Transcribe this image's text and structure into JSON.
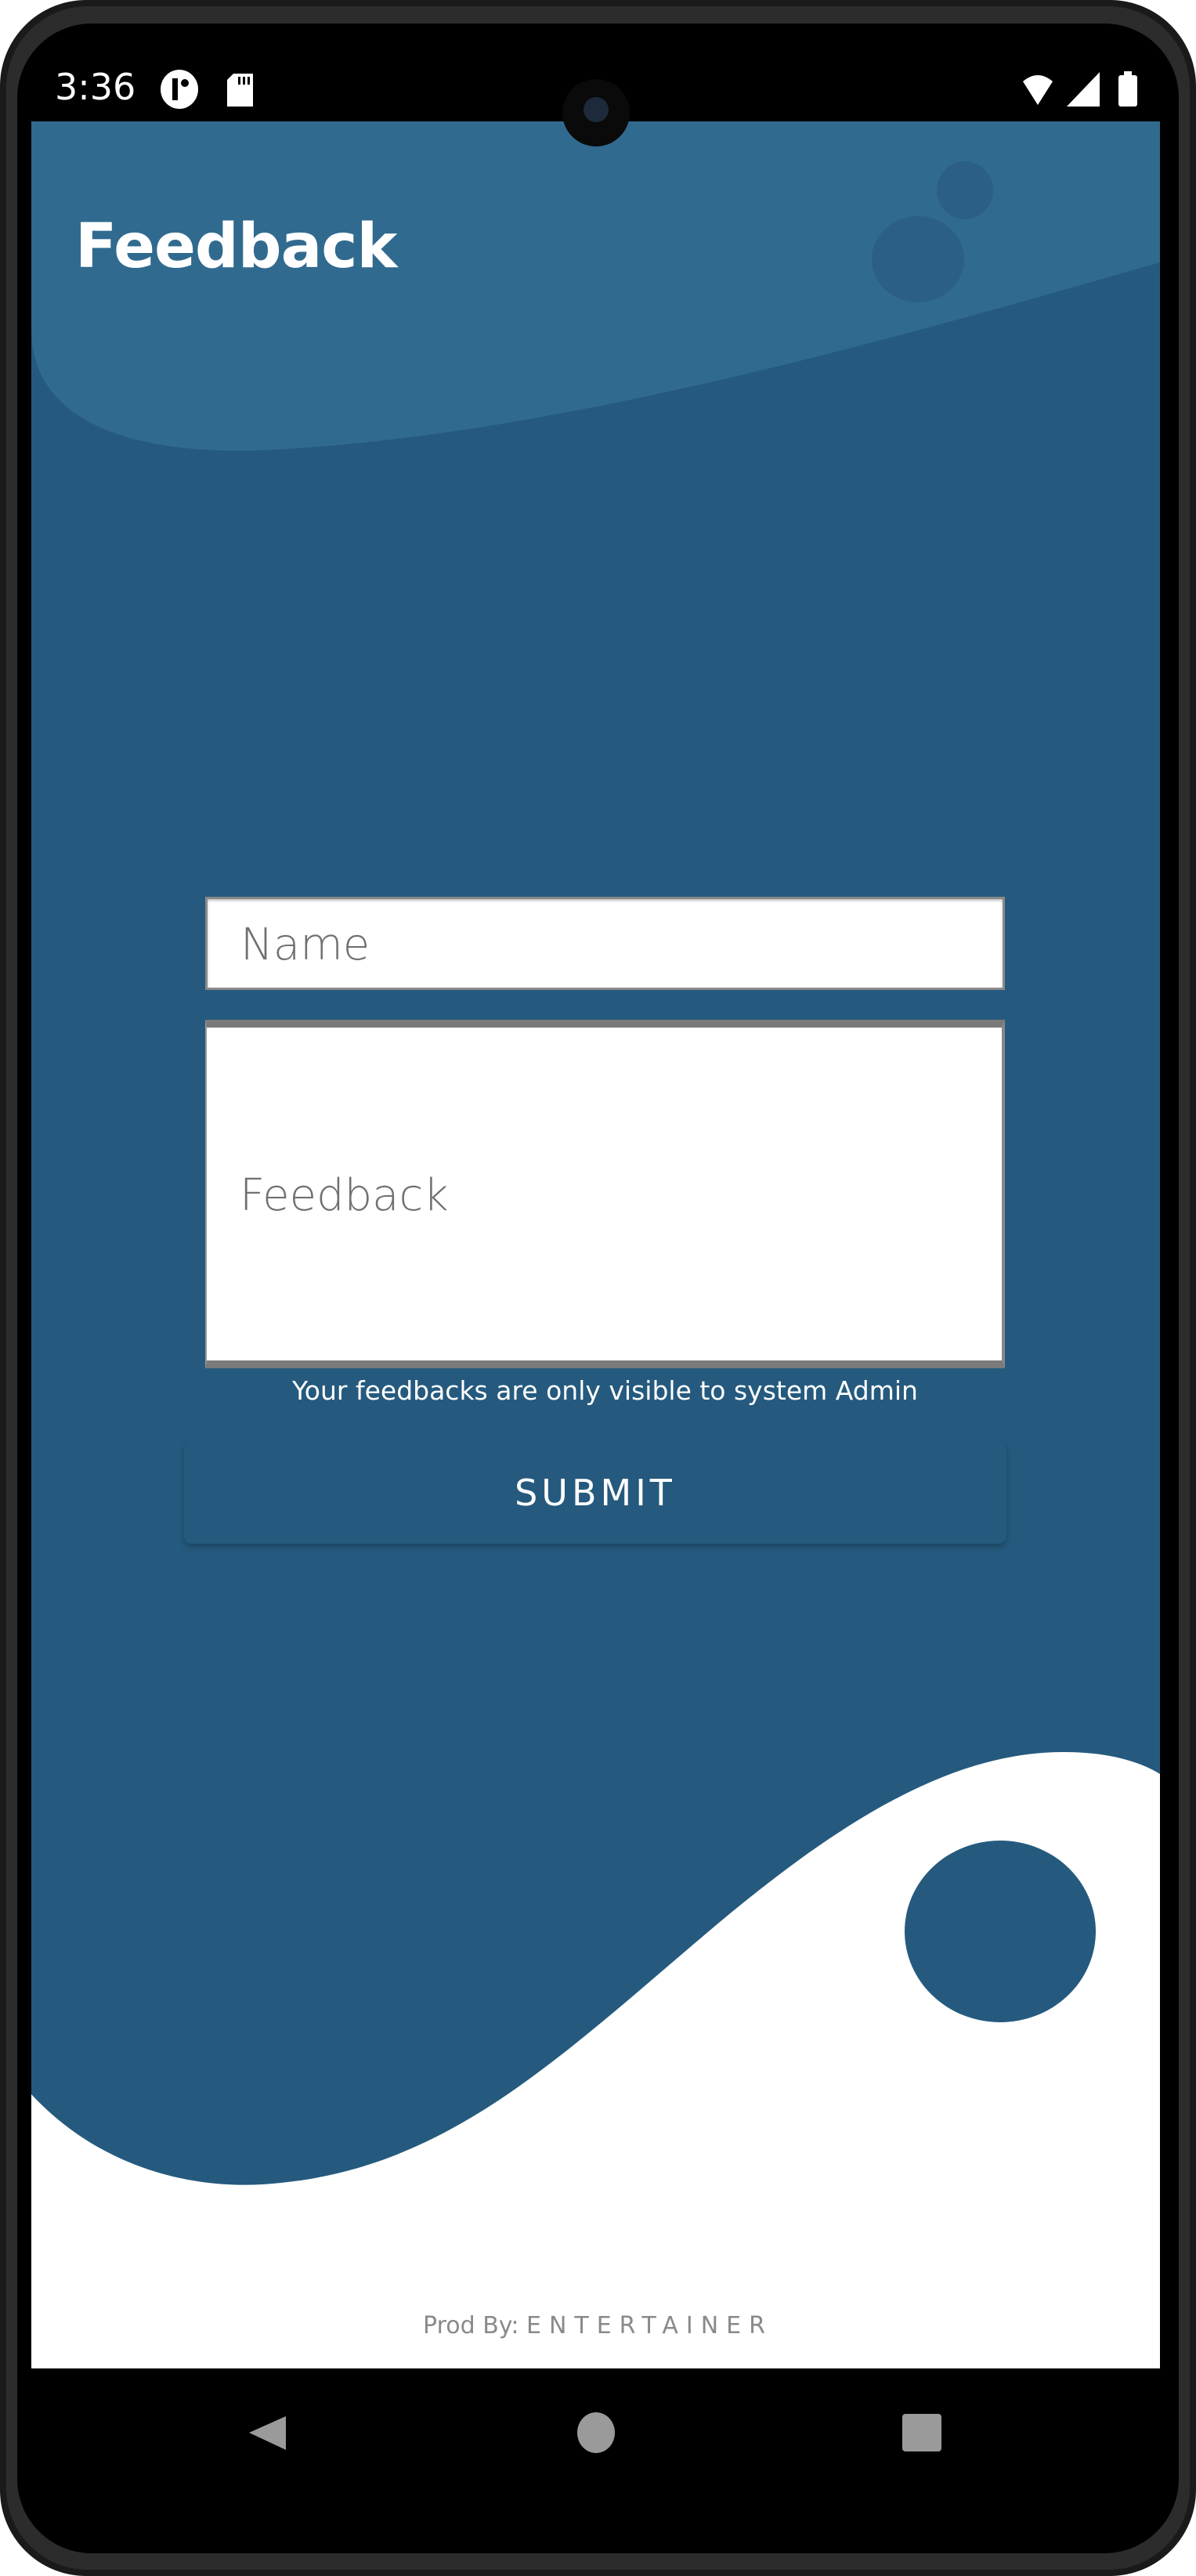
{
  "status_bar": {
    "time": "3:36",
    "left_icons": [
      "notification-circle-icon",
      "sd-card-icon"
    ],
    "right_icons": [
      "wifi-icon",
      "cell-signal-icon",
      "battery-icon"
    ]
  },
  "header": {
    "title": "Feedback"
  },
  "form": {
    "name_placeholder": "Name",
    "feedback_placeholder": "Feedback",
    "helper_text": "Your feedbacks are only visible to system Admin",
    "submit_label": "SUBMIT"
  },
  "footer": {
    "prod_prefix": "Prod By: ",
    "prod_brand": "ENTERTAINER"
  },
  "nav_bar": {
    "icons": [
      "back-icon",
      "home-icon",
      "recents-icon"
    ]
  },
  "colors": {
    "primary": "#255a7e",
    "header_light": "#316a8f",
    "background_white": "#ffffff"
  }
}
